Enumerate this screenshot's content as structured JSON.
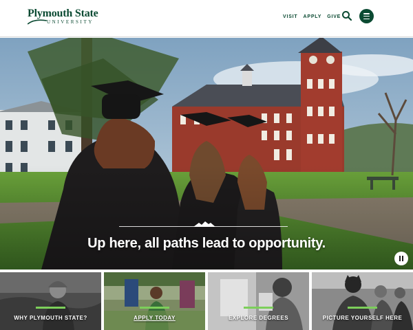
{
  "header": {
    "logo_name": "Plymouth State",
    "logo_sub": "UNIVERSITY",
    "nav": [
      {
        "label": "VISIT"
      },
      {
        "label": "APPLY"
      },
      {
        "label": "GIVE"
      }
    ],
    "icons": {
      "search": "search-icon",
      "menu": "hamburger-menu-icon"
    }
  },
  "hero": {
    "headline": "Up here, all paths lead to opportunity.",
    "icons": {
      "divider": "mountain-icon",
      "pause": "pause-icon"
    }
  },
  "tiles": [
    {
      "label": "WHY PLYMOUTH STATE?"
    },
    {
      "label": "APPLY TODAY"
    },
    {
      "label": "EXPLORE DEGREES"
    },
    {
      "label": "PICTURE YOURSELF HERE"
    }
  ],
  "colors": {
    "brand_green": "#0b4a32",
    "accent_green": "#7ccf5a",
    "white": "#ffffff"
  }
}
